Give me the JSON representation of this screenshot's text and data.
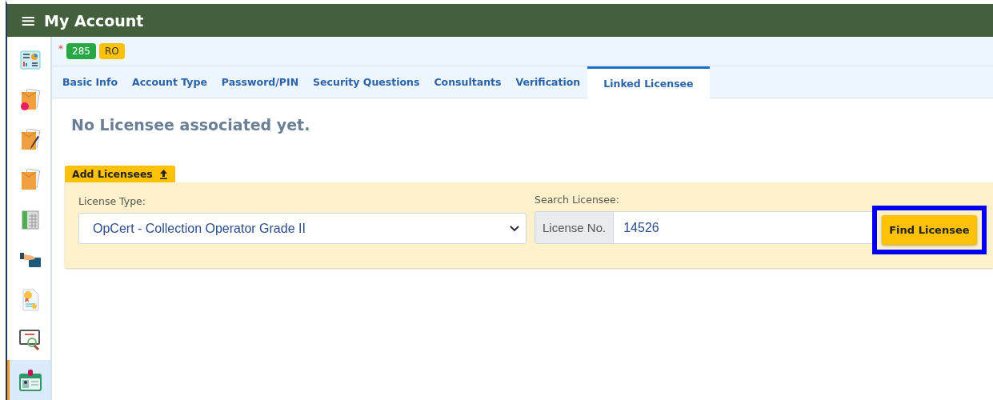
{
  "header": {
    "menu_icon": "≡",
    "title": "My Account"
  },
  "sidebar": {
    "items": [
      {
        "selected": false
      },
      {
        "selected": false
      },
      {
        "selected": false
      },
      {
        "selected": false
      },
      {
        "selected": false
      },
      {
        "selected": false
      },
      {
        "selected": false
      },
      {
        "selected": false
      },
      {
        "selected": true
      }
    ]
  },
  "status": {
    "required_mark": "*",
    "badges": [
      {
        "text": "285",
        "color": "#28a745"
      },
      {
        "text": "RO",
        "color": "#ffc107"
      }
    ]
  },
  "tabs": [
    {
      "label": "Basic Info",
      "selected": false
    },
    {
      "label": "Account Type",
      "selected": false
    },
    {
      "label": "Password/PIN",
      "selected": false
    },
    {
      "label": "Security Questions",
      "selected": false
    },
    {
      "label": "Consultants",
      "selected": false
    },
    {
      "label": "Verification",
      "selected": false
    },
    {
      "label": "Linked Licensee",
      "selected": true
    }
  ],
  "message": "No Licensee associated yet.",
  "add_panel": {
    "title": "Add Licensees",
    "license_type": {
      "label": "License Type:",
      "value": "OpCert - Collection Operator Grade II"
    },
    "search": {
      "label": "Search Licensee:",
      "prefix": "License No.",
      "value": "14526"
    },
    "button": {
      "label": "Find Licensee",
      "highlighted": true
    }
  }
}
